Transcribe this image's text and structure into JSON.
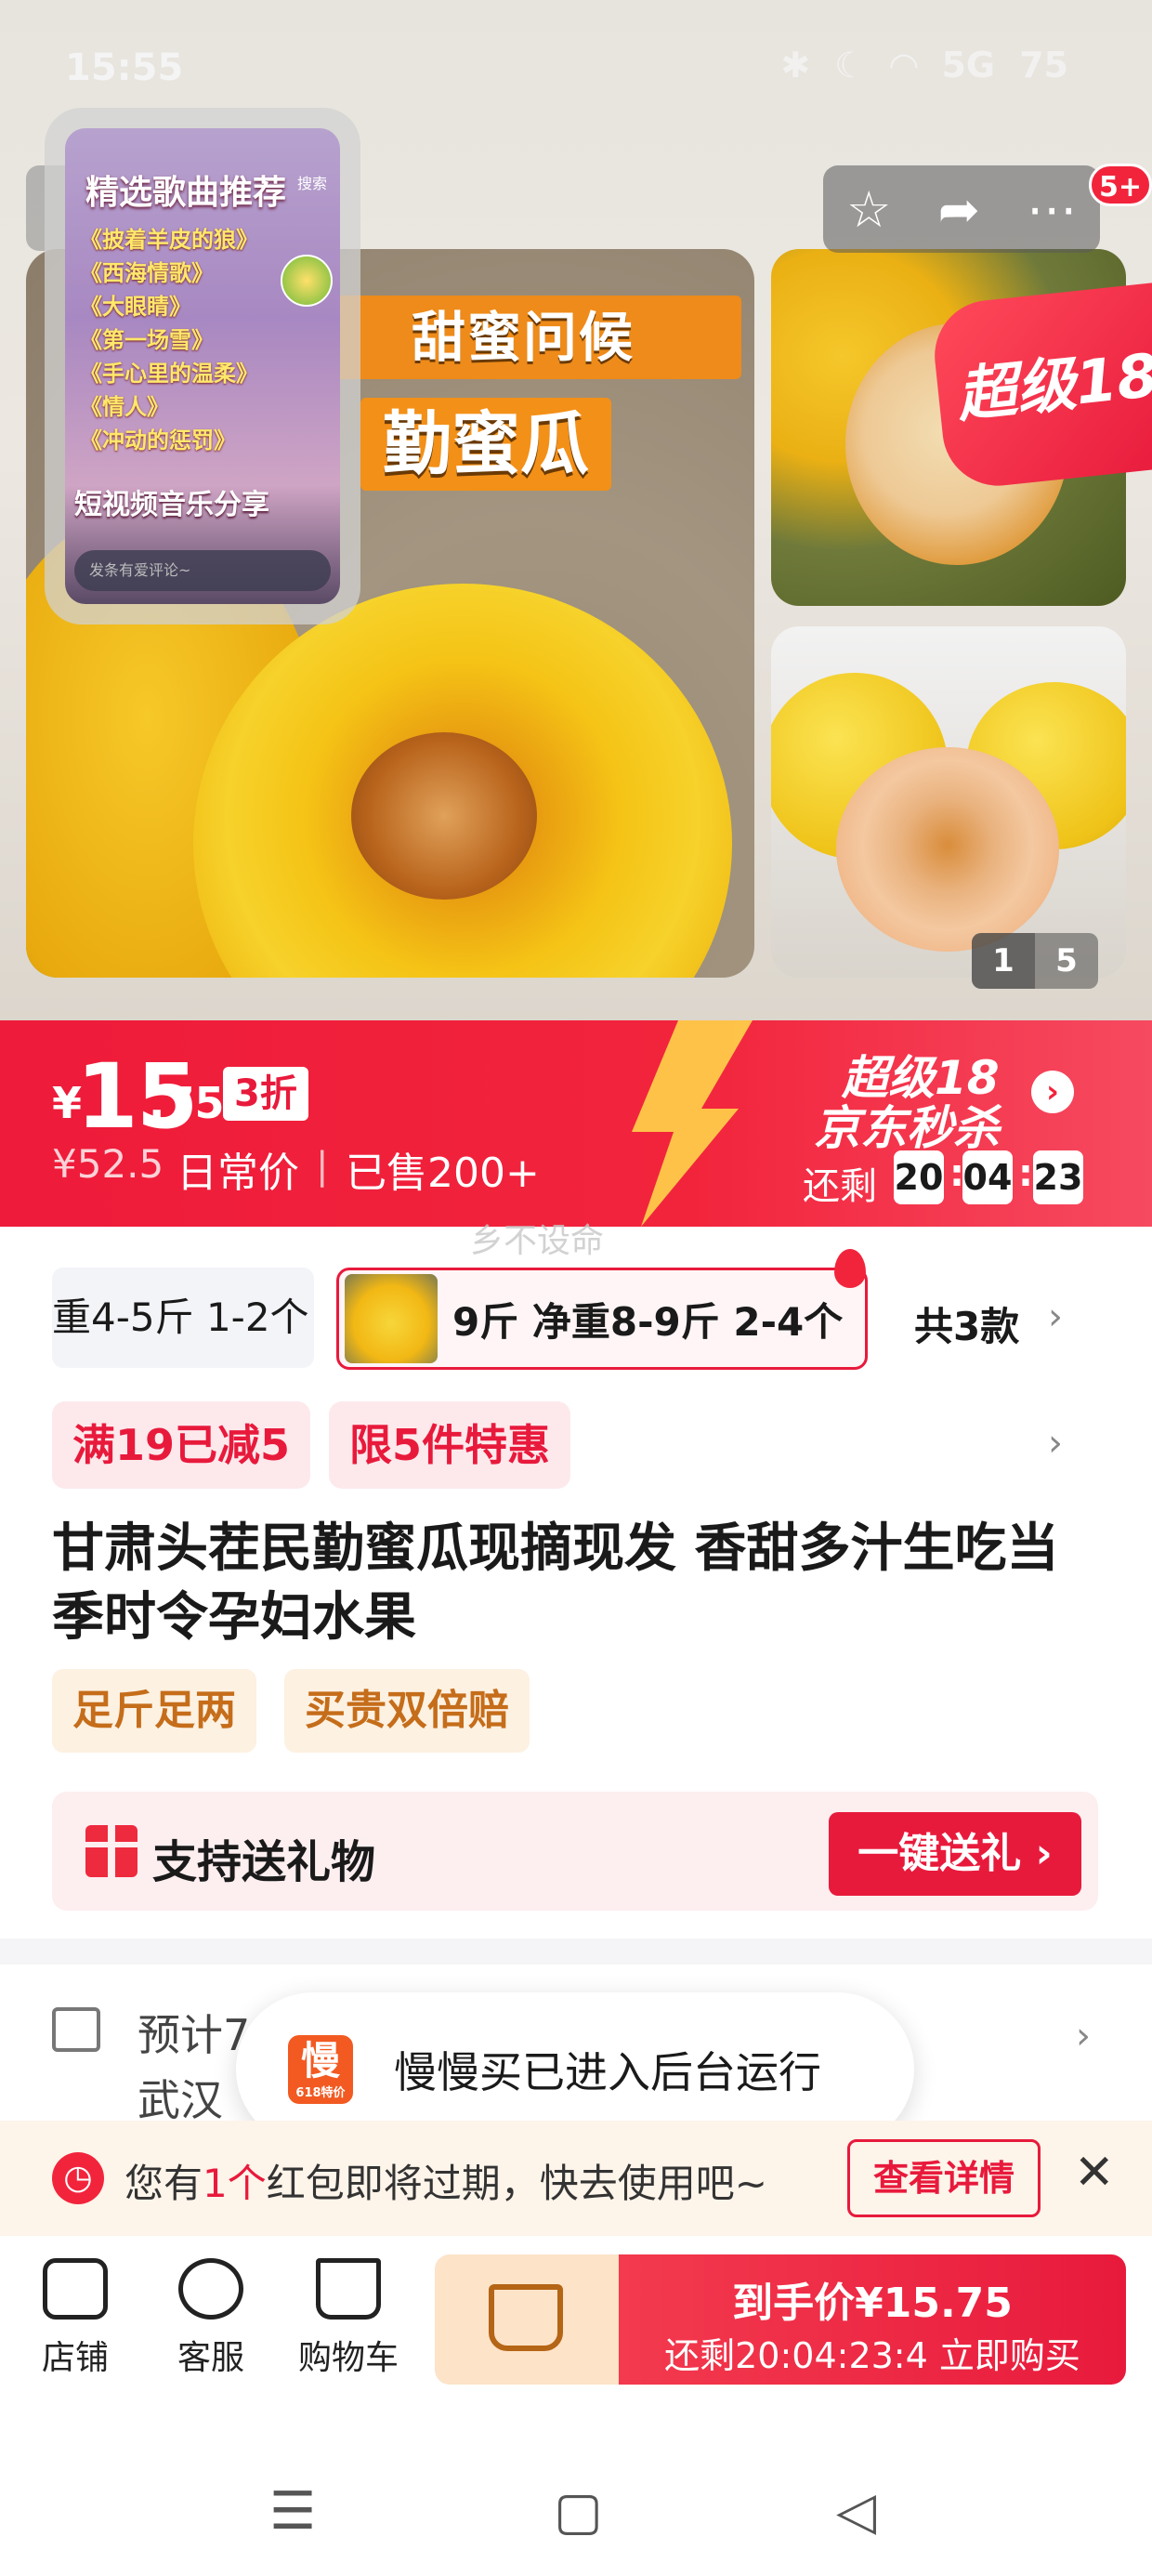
{
  "status_bar": {
    "time": "15:55",
    "network": "5G",
    "battery": "75"
  },
  "pip_video": {
    "title": "精选歌曲推荐",
    "search": "搜索",
    "songs": [
      "《披着羊皮的狼》",
      "《西海情歌》",
      "《大眼睛》",
      "《第一场雪》",
      "《手心里的温柔》",
      "《情人》",
      "《冲动的惩罚》"
    ],
    "footer": "短视频音乐分享",
    "comment_placeholder": "发条有爱评论~"
  },
  "hero": {
    "banner_line1": "甜蜜问候",
    "banner_line2": "勤蜜瓜",
    "super_tag": "超级18",
    "cart_badge": "5+",
    "pager_current": "1",
    "pager_total": "5"
  },
  "price": {
    "currency": "¥",
    "integer": "15",
    "decimal": ".75",
    "discount": "3折",
    "original": "¥52.5",
    "daily_label": "日常价",
    "sold": "已售200+",
    "campaign_line1": "超级18",
    "campaign_line2": "京东秒杀",
    "remain_label": "还剩",
    "countdown": [
      "20",
      "04",
      "23"
    ]
  },
  "watermark": "乡不设命",
  "variants": {
    "option_a": "重4-5斤 1-2个",
    "option_b": "9斤 净重8-9斤 2-4个",
    "total": "共3款"
  },
  "promos": [
    "满19已减5",
    "限5件特惠"
  ],
  "product_title": "甘肃头茬民勤蜜瓜现摘现发  香甜多汁生吃当季时令孕妇水果",
  "service_tags": [
    "足斤足两",
    "买贵双倍赔"
  ],
  "gift": {
    "label": "支持送礼物",
    "button": "一键送礼 ›"
  },
  "shipping": {
    "line1": "预计7",
    "line2": "武汉"
  },
  "toast": {
    "logo": "慢",
    "logo_sub": "618特价",
    "message": "慢慢买已进入后台运行"
  },
  "red_packet": {
    "prefix": "您有",
    "count": "1个",
    "suffix": "红包即将过期，快去使用吧~",
    "button": "查看详情"
  },
  "bottom_bar": {
    "shop": "店铺",
    "service": "客服",
    "cart": "购物车",
    "buy_line1": "到手价¥15.75",
    "buy_line2": "还剩20:04:23:4  立即购买"
  },
  "colors": {
    "accent": "#E81A3C",
    "gift_bg": "#FDEEF0",
    "service_tag": "#C56D1A",
    "cart_btn_bg": "#FDE3C8"
  }
}
